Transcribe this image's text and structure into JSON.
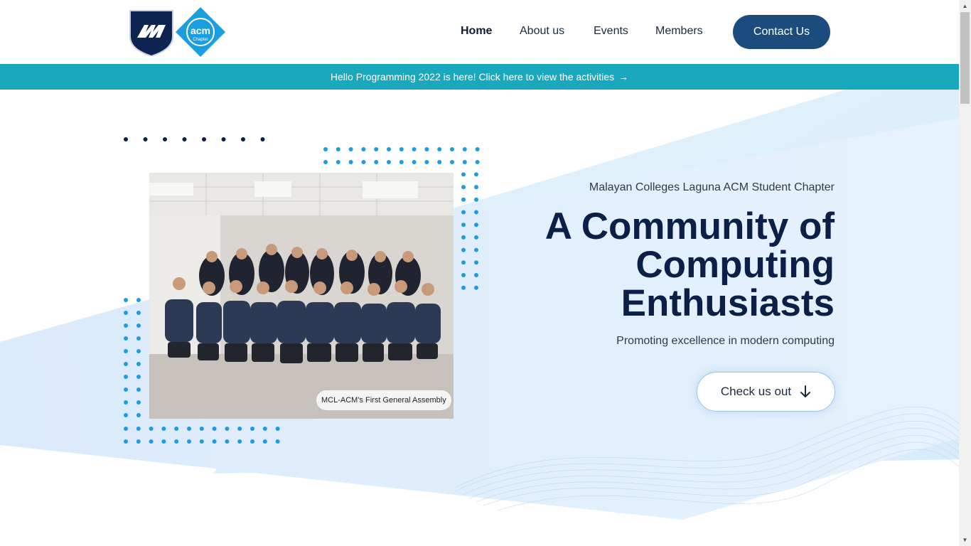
{
  "brand": {
    "logo_primary": "Malayan Colleges Laguna logo",
    "logo_secondary_text": "acm",
    "logo_secondary_subtext": "Chapter"
  },
  "nav": {
    "items": [
      {
        "label": "Home",
        "active": true
      },
      {
        "label": "About us",
        "active": false
      },
      {
        "label": "Events",
        "active": false
      },
      {
        "label": "Members",
        "active": false
      }
    ],
    "contact_label": "Contact Us"
  },
  "announcement": {
    "text": "Hello Programming 2022 is here! Click here to view the activities",
    "arrow": "→"
  },
  "hero": {
    "eyebrow": "Malayan Colleges Laguna ACM Student Chapter",
    "title": "A Community of Computing Enthusiasts",
    "subtitle": "Promoting excellence in modern computing",
    "cta_label": "Check us out",
    "cta_icon": "arrow-down-icon",
    "photo_caption": "MCL-ACM's First General Assembly"
  },
  "colors": {
    "navy": "#0c2047",
    "button_blue": "#1c4c7e",
    "teal_banner": "#1aa9bc",
    "dot_blue": "#1a9ee0",
    "dot_navy": "#0b1f4a",
    "hero_light": "#dceefa"
  }
}
